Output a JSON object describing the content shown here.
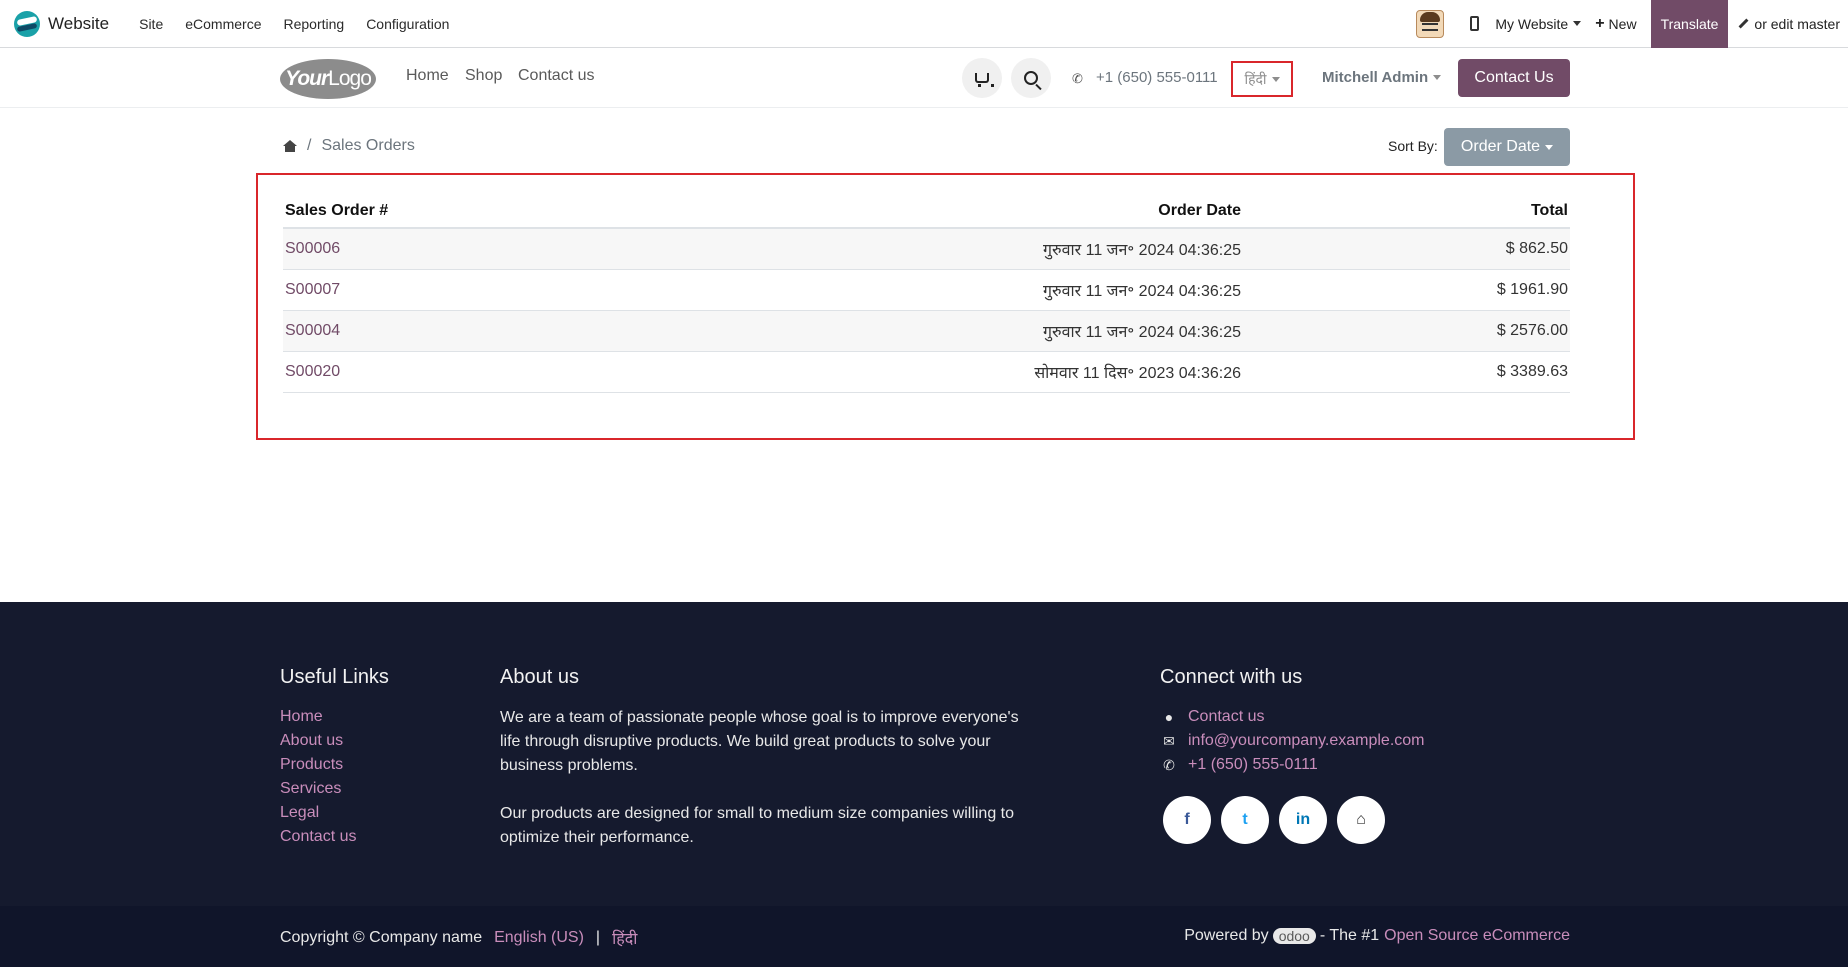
{
  "admin": {
    "app_name": "Website",
    "menus": [
      "Site",
      "eCommerce",
      "Reporting",
      "Configuration"
    ],
    "my_website": "My Website",
    "new_label": "New",
    "translate_label": "Translate",
    "edit_master_label": "or edit master"
  },
  "header": {
    "logo_bold": "Your",
    "logo_thin": "Logo",
    "nav": [
      "Home",
      "Shop",
      "Contact us"
    ],
    "phone": "+1 (650) 555-0111",
    "language": "हिंदी",
    "user": "Mitchell Admin",
    "contact_button": "Contact Us"
  },
  "breadcrumb": {
    "separator": "/",
    "current": "Sales Orders"
  },
  "sort": {
    "label": "Sort By:",
    "value": "Order Date"
  },
  "orders": {
    "headers": [
      "Sales Order #",
      "Order Date",
      "Total"
    ],
    "rows": [
      {
        "number": "S00006",
        "date": "गुरुवार 11 जन॰ 2024  04:36:25",
        "total": "$ 862.50"
      },
      {
        "number": "S00007",
        "date": "गुरुवार 11 जन॰ 2024  04:36:25",
        "total": "$ 1961.90"
      },
      {
        "number": "S00004",
        "date": "गुरुवार 11 जन॰ 2024  04:36:25",
        "total": "$ 2576.00"
      },
      {
        "number": "S00020",
        "date": "सोमवार 11 दिस॰ 2023  04:36:26",
        "total": "$ 3389.63"
      }
    ]
  },
  "footer": {
    "useful_links_title": "Useful Links",
    "useful_links": [
      "Home",
      "About us",
      "Products",
      "Services",
      "Legal",
      "Contact us"
    ],
    "about_title": "About us",
    "about_p1_line1": "We are a team of passionate people whose goal is to improve everyone's",
    "about_p1_line2": "life through disruptive products. We build great products to solve your",
    "about_p1_line3": "business problems.",
    "about_p2_line1": "Our products are designed for small to medium size companies willing to",
    "about_p2_line2": "optimize their performance.",
    "connect_title": "Connect with us",
    "connect_contact": "Contact us",
    "connect_email": "info@yourcompany.example.com",
    "connect_phone": "+1 (650) 555-0111",
    "social": [
      {
        "icon": "facebook-icon",
        "glyph": "f",
        "color": "#3b5998"
      },
      {
        "icon": "twitter-icon",
        "glyph": "t",
        "color": "#1da1f2"
      },
      {
        "icon": "linkedin-icon",
        "glyph": "in",
        "color": "#0077b5"
      },
      {
        "icon": "home-icon",
        "glyph": "⌂",
        "color": "#333333"
      }
    ]
  },
  "bottom": {
    "copyright": "Copyright © Company name",
    "lang_en": "English (US)",
    "lang_sep": "|",
    "lang_hi": "हिंदी",
    "powered_by": "Powered by",
    "odoo": "odoo",
    "the_1": "- The #1",
    "open_source": "Open Source eCommerce"
  },
  "colors": {
    "brand": "#714b67",
    "highlight": "#d9262b",
    "footer_bg": "#151a2e",
    "link_pink": "#c98dbb"
  }
}
